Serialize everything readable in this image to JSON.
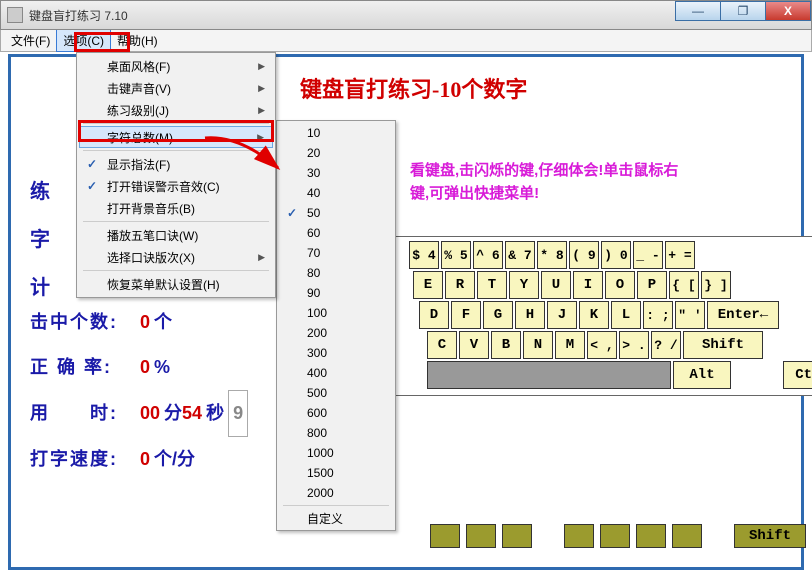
{
  "title": "键盘盲打练习 7.10",
  "menubar": {
    "file": "文件(F)",
    "options": "选项(C)",
    "help": "帮助(H)"
  },
  "heading": "键盘盲打练习-10个数字",
  "magenta_line1": "看键盘,击闪烁的键,仔细体会!单击鼠标右",
  "magenta_line2": "键,可弹出快捷菜单!",
  "menu1": {
    "desktop_style": "桌面风格(F)",
    "keystroke_sound": "击键声音(V)",
    "practice_level": "练习级别(J)",
    "char_total": "字符总数(M)",
    "show_fingering": "显示指法(F)",
    "open_error_sound": "打开错误警示音效(C)",
    "open_bg_music": "打开背景音乐(B)",
    "play_wubi": "播放五笔口诀(W)",
    "select_wubi_ver": "选择口诀版次(X)",
    "restore_defaults": "恢复菜单默认设置(H)"
  },
  "menu2": {
    "items": [
      "10",
      "20",
      "30",
      "40",
      "50",
      "60",
      "70",
      "80",
      "90",
      "100",
      "200",
      "300",
      "400",
      "500",
      "600",
      "800",
      "1000",
      "1500",
      "2000"
    ],
    "custom": "自定义",
    "selected": "50"
  },
  "stats": {
    "hits_lbl": "击中个数:",
    "hits_val": "0",
    "hits_unit": "个",
    "accuracy_lbl": "正 确 率:",
    "accuracy_val": "0",
    "accuracy_unit": "%",
    "time_lbl": "用　　时:",
    "time_min": "00",
    "time_min_unit": "分",
    "time_sec": "54",
    "time_sec_unit": "秒",
    "time_faint": "9",
    "speed_lbl": "打字速度:",
    "speed_val": "0",
    "speed_unit": "个/分"
  },
  "left_labels": {
    "l1": "练",
    "l2": "字",
    "l3": "计"
  },
  "keys": {
    "row1": [
      "$ 4",
      "% 5",
      "^ 6",
      "& 7",
      "* 8",
      "( 9",
      ") 0",
      "_ -",
      "+ ="
    ],
    "row2": [
      "E",
      "R",
      "T",
      "Y",
      "U",
      "I",
      "O",
      "P",
      "{ [",
      "} ]"
    ],
    "row3": [
      "D",
      "F",
      "G",
      "H",
      "J",
      "K",
      "L",
      ": ;",
      "\" '",
      "Enter←"
    ],
    "row4": [
      "C",
      "V",
      "B",
      "N",
      "M",
      "< ,",
      "> .",
      "? /",
      "Shift"
    ],
    "row5": [
      "",
      "",
      "Alt",
      "",
      "Ctrl"
    ],
    "bottom_shift": "Shift"
  },
  "win": {
    "min": "—",
    "max": "❐",
    "close": "X"
  }
}
